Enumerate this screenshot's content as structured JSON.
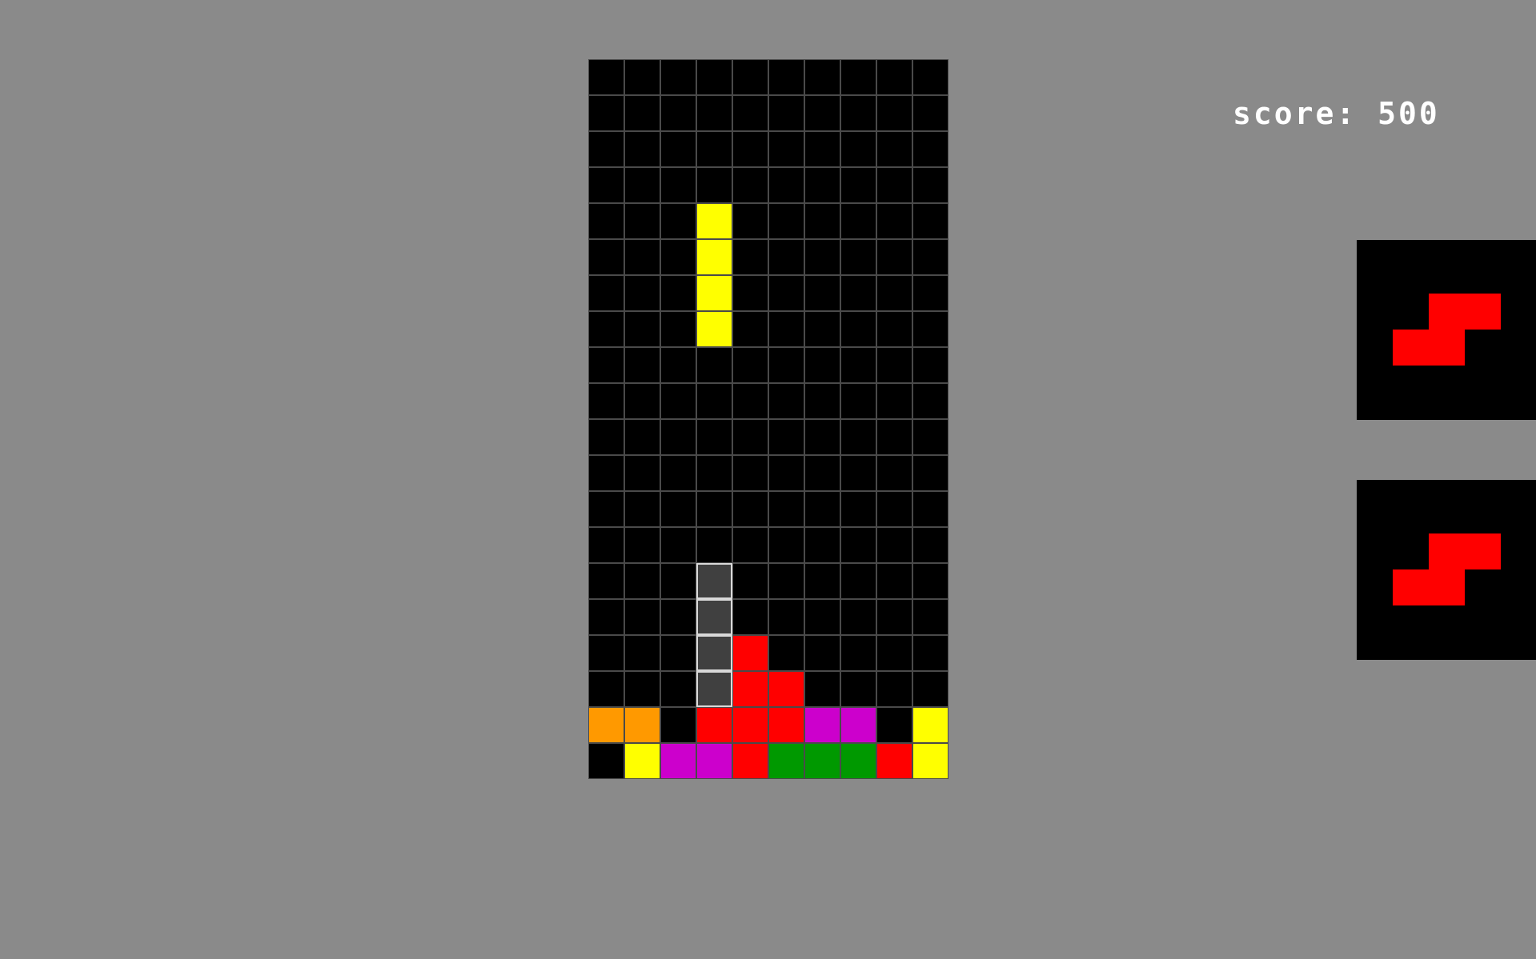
{
  "score": {
    "label": "score:",
    "value": 500
  },
  "colors": {
    "empty": "#000000",
    "grid_line": "#4a4a4a",
    "ghost": "#404040",
    "ghost_border": "#d9d9d9",
    "I": "#ffff00",
    "O": "#ffff00",
    "Z": "#ff0000",
    "S": "#009900",
    "T": "#cc00cc",
    "L": "#ff9900",
    "background": "#8a8a8a"
  },
  "board": {
    "columns": 10,
    "rows": 20,
    "active_piece": {
      "type": "I",
      "color": "#ffff00",
      "cells": [
        [
          3,
          4
        ],
        [
          3,
          5
        ],
        [
          3,
          6
        ],
        [
          3,
          7
        ]
      ]
    },
    "ghost_piece": {
      "cells": [
        [
          3,
          14
        ],
        [
          3,
          15
        ],
        [
          3,
          16
        ],
        [
          3,
          17
        ]
      ]
    },
    "locked": [
      {
        "col": 4,
        "row": 16,
        "color": "#ff0000"
      },
      {
        "col": 4,
        "row": 17,
        "color": "#ff0000"
      },
      {
        "col": 5,
        "row": 17,
        "color": "#ff0000"
      },
      {
        "col": 0,
        "row": 18,
        "color": "#ff9900"
      },
      {
        "col": 1,
        "row": 18,
        "color": "#ff9900"
      },
      {
        "col": 3,
        "row": 18,
        "color": "#ff0000"
      },
      {
        "col": 4,
        "row": 18,
        "color": "#ff0000"
      },
      {
        "col": 5,
        "row": 18,
        "color": "#ff0000"
      },
      {
        "col": 6,
        "row": 18,
        "color": "#cc00cc"
      },
      {
        "col": 7,
        "row": 18,
        "color": "#cc00cc"
      },
      {
        "col": 9,
        "row": 18,
        "color": "#ffff00"
      },
      {
        "col": 1,
        "row": 19,
        "color": "#ffff00"
      },
      {
        "col": 2,
        "row": 19,
        "color": "#cc00cc"
      },
      {
        "col": 3,
        "row": 19,
        "color": "#cc00cc"
      },
      {
        "col": 4,
        "row": 19,
        "color": "#ff0000"
      },
      {
        "col": 5,
        "row": 19,
        "color": "#009900"
      },
      {
        "col": 6,
        "row": 19,
        "color": "#009900"
      },
      {
        "col": 7,
        "row": 19,
        "color": "#009900"
      },
      {
        "col": 8,
        "row": 19,
        "color": "#ff0000"
      },
      {
        "col": 9,
        "row": 19,
        "color": "#ffff00"
      }
    ]
  },
  "next_pieces": [
    {
      "type": "S",
      "color": "#ff0000",
      "cells": [
        [
          1,
          0
        ],
        [
          2,
          0
        ],
        [
          0,
          1
        ],
        [
          1,
          1
        ]
      ]
    },
    {
      "type": "S",
      "color": "#ff0000",
      "cells": [
        [
          1,
          0
        ],
        [
          2,
          0
        ],
        [
          0,
          1
        ],
        [
          1,
          1
        ]
      ]
    }
  ]
}
